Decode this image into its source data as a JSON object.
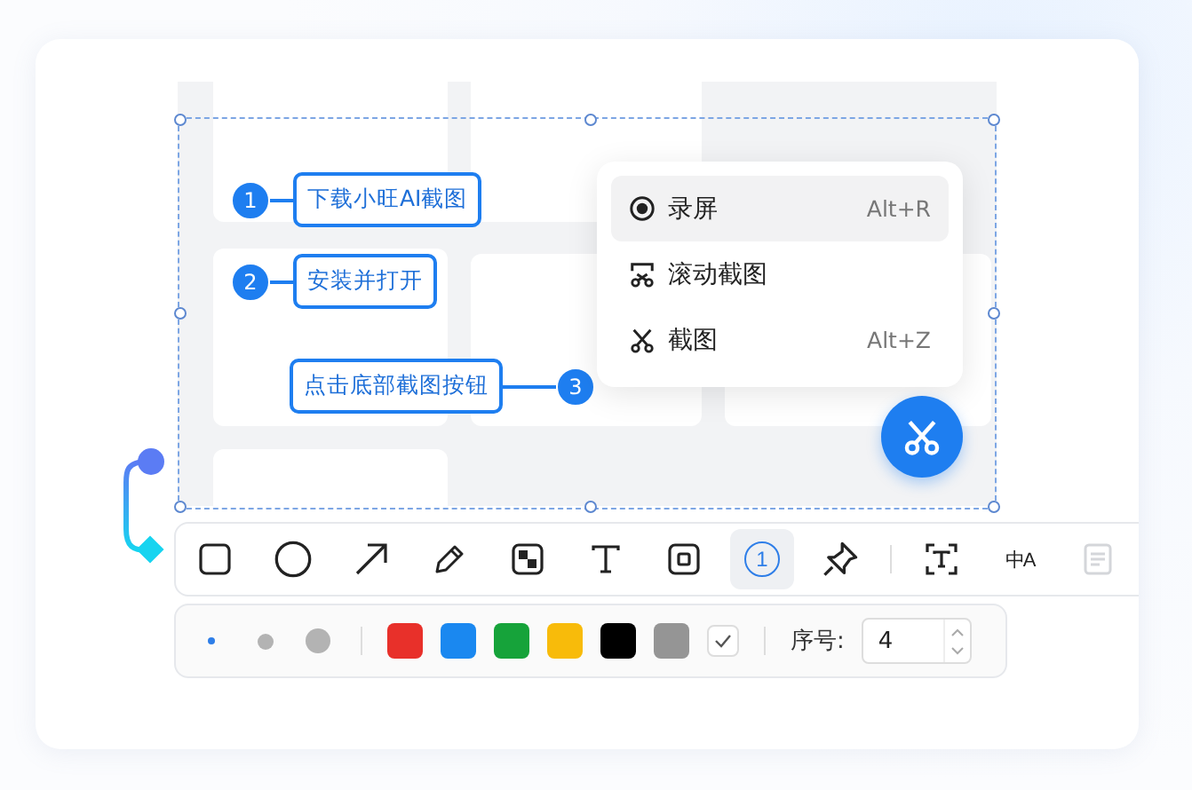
{
  "callouts": [
    {
      "number": "1",
      "text": "下载小旺AI截图"
    },
    {
      "number": "2",
      "text": "安装并打开"
    },
    {
      "number": "3",
      "text": "点击底部截图按钮"
    }
  ],
  "menu": [
    {
      "kind": "record",
      "label": "录屏",
      "shortcut": "Alt+R",
      "selected": true
    },
    {
      "kind": "scroll",
      "label": "滚动截图",
      "selected": false
    },
    {
      "kind": "screenshot",
      "label": "截图",
      "shortcut": "Alt+Z",
      "selected": false
    }
  ],
  "tools": [
    {
      "kind": "rect",
      "selected": false
    },
    {
      "kind": "circle",
      "selected": false
    },
    {
      "kind": "arrow",
      "selected": false
    },
    {
      "kind": "pencil",
      "selected": false
    },
    {
      "kind": "mosaic",
      "selected": false
    },
    {
      "kind": "text",
      "selected": false
    },
    {
      "kind": "frame",
      "selected": false
    },
    {
      "kind": "number",
      "label": "1",
      "selected": true
    },
    {
      "kind": "pin",
      "selected": false
    },
    {
      "kind": "divider"
    },
    {
      "kind": "ocr",
      "selected": false
    },
    {
      "kind": "translate",
      "label": "中A",
      "selected": false
    },
    {
      "kind": "more",
      "selected": false,
      "disabled": true
    }
  ],
  "sizes": [
    {
      "selected": true
    },
    {
      "selected": false
    },
    {
      "selected": false
    }
  ],
  "colors": [
    {
      "color": "#e8302a",
      "selected": false
    },
    {
      "color": "#1a88f0",
      "selected": false
    },
    {
      "color": "#16a33a",
      "selected": false
    },
    {
      "color": "#f8bb0a",
      "selected": false
    },
    {
      "color": "#000000",
      "selected": false
    },
    {
      "color": "#959595",
      "selected": false
    }
  ],
  "fill_checkbox": {
    "checked": true
  },
  "sequence": {
    "label": "序号:",
    "value": "4"
  }
}
